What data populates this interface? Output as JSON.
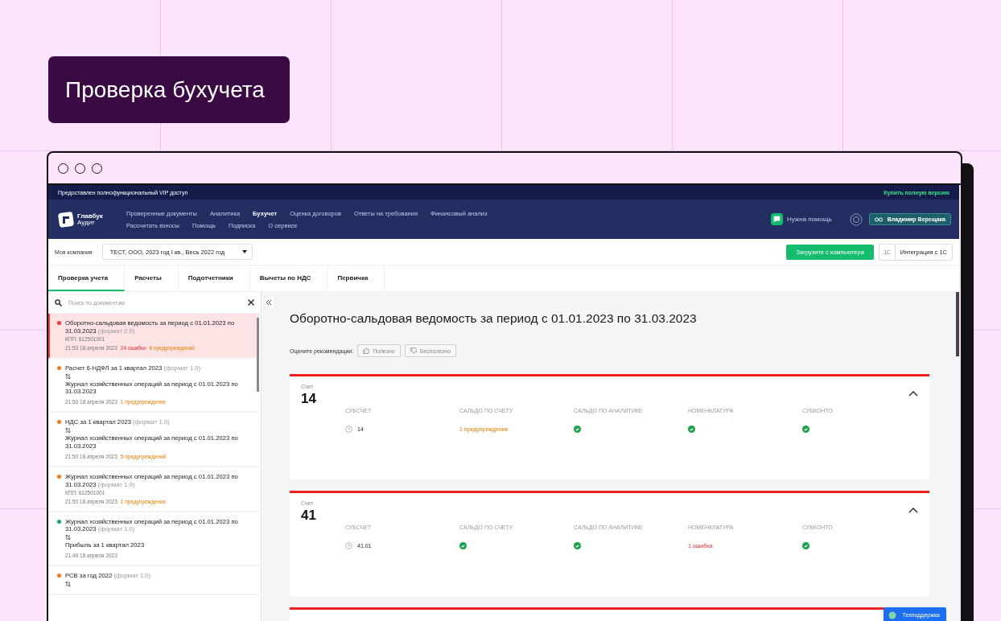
{
  "banner": {
    "title": "Проверка бухучета"
  },
  "app": {
    "top_strip": {
      "text": "Предоставлен полнофункциональный VIP доступ",
      "link": "Купить полную версию"
    },
    "logo": {
      "name": "Главбук",
      "sub": "Аудит"
    },
    "nav_rows": [
      [
        {
          "label": "Проверенные документы",
          "selected": false
        },
        {
          "label": "Аналитика",
          "selected": false
        },
        {
          "label": "Бухучет",
          "selected": true
        },
        {
          "label": "Оценка договоров",
          "selected": false
        },
        {
          "label": "Ответы на требования",
          "selected": false
        },
        {
          "label": "Финансовый анализ",
          "selected": false
        }
      ],
      [
        {
          "label": "Рассчитать взносы",
          "selected": false
        },
        {
          "label": "Помощь",
          "selected": false
        },
        {
          "label": "Подписка",
          "selected": false
        },
        {
          "label": "О сервисе",
          "selected": false
        }
      ]
    ],
    "help": "Нужна помощь",
    "user": "Владимир Верещака",
    "toolbar": {
      "company_label": "Моя компания",
      "company_value": "ТЕСТ, ООО,  2023 год I кв., Весь 2022 год",
      "upload": "Загрузите с компьютера",
      "integration_badge": "1С",
      "integration": "Интеграция с 1С"
    },
    "tabs": [
      {
        "label": "Проверка учета",
        "selected": true
      },
      {
        "label": "Расчеты",
        "selected": false
      },
      {
        "label": "Подотчетники",
        "selected": false
      },
      {
        "label": "Вычеты по НДС",
        "selected": false
      },
      {
        "label": "Первичка",
        "selected": false
      }
    ],
    "sidebar": {
      "search": {
        "placeholder": "Поиск по документам"
      },
      "items": [
        {
          "title": "Оборотно-сальдовая ведомость за период с 01.01.2023 по 31.03.2023",
          "format": "(формат 2.0)",
          "kpp": "КПП: 612501001",
          "date": "21:50 18 апреля 2023",
          "color": "#f03a3a",
          "selected": true,
          "badges": [
            {
              "kind": "error",
              "text": "24 ошибки"
            },
            {
              "kind": "warning",
              "text": "8 предупреждений"
            }
          ]
        },
        {
          "title": "Расчет 6-НДФЛ за 1 квартал 2023",
          "format": "(формат 1.0)",
          "swap": true,
          "compared_with": "Журнал хозяйственных операций за период с 01.01.2023 по 31.03.2023",
          "date": "21:50 18 апреля 2023",
          "color": "#f07a1a",
          "selected": false,
          "badges": [
            {
              "kind": "warning",
              "text": "1 предупреждение"
            }
          ]
        },
        {
          "title": "НДС за 1 квартал 2023",
          "format": "(формат 1.0)",
          "swap": true,
          "compared_with": "Журнал хозяйственных операций за период с 01.01.2023 по 31.03.2023",
          "date": "21:50 18 апреля 2023",
          "color": "#f07a1a",
          "selected": false,
          "badges": [
            {
              "kind": "warning",
              "text": "5 предупреждений"
            }
          ]
        },
        {
          "title": "Журнал хозяйственных операций за период с 01.01.2023 по 31.03.2023",
          "format": "(формат 1.0)",
          "kpp": "КПП: 612501001",
          "date": "21:50 18 апреля 2023",
          "color": "#f07a1a",
          "selected": false,
          "badges": [
            {
              "kind": "warning",
              "text": "1 предупреждение"
            }
          ]
        },
        {
          "title": "Журнал хозяйственных операций за период с 01.01.2023 по 31.03.2023",
          "format": "(формат 1.0)",
          "swap": true,
          "compared_with": "Прибыль за 1 квартал 2023",
          "date": "21:49 18 апреля 2023",
          "color": "#14a85a",
          "selected": false
        },
        {
          "title": "РСВ за год 2022",
          "format": "(формат 1.0)",
          "swap": true,
          "color": "#f07a1a",
          "selected": false
        }
      ]
    },
    "main": {
      "title": "Оборотно-сальдовая ведомость за период с 01.01.2023 по 31.03.2023",
      "rate_label": "Оцените рекомендации:",
      "useful": "Полезно",
      "useless": "Бесполезно",
      "cards": [
        {
          "label": "Счет",
          "account": "14",
          "expanded": true,
          "columns": [
            "СУБСЧЕТ",
            "САЛЬДО ПО СЧЕТУ",
            "САЛЬДО ПО АНАЛИТИКЕ",
            "НОМЕНКЛАТУРА",
            "СУБКОНТО"
          ],
          "subaccount": "14",
          "cells": [
            {
              "kind": "warning",
              "text": "1 предупреждение"
            },
            {
              "kind": "ok"
            },
            {
              "kind": "ok"
            },
            {
              "kind": "ok"
            }
          ]
        },
        {
          "label": "Счет",
          "account": "41",
          "expanded": true,
          "columns": [
            "СУБСЧЕТ",
            "САЛЬДО ПО СЧЕТУ",
            "САЛЬДО ПО АНАЛИТИКЕ",
            "НОМЕНКЛАТУРА",
            "СУБКОНТО"
          ],
          "subaccount": "41.01",
          "cells": [
            {
              "kind": "ok"
            },
            {
              "kind": "ok"
            },
            {
              "kind": "error",
              "text": "1 ошибка"
            },
            {
              "kind": "ok"
            }
          ]
        }
      ]
    },
    "support": "Техподдержка"
  }
}
